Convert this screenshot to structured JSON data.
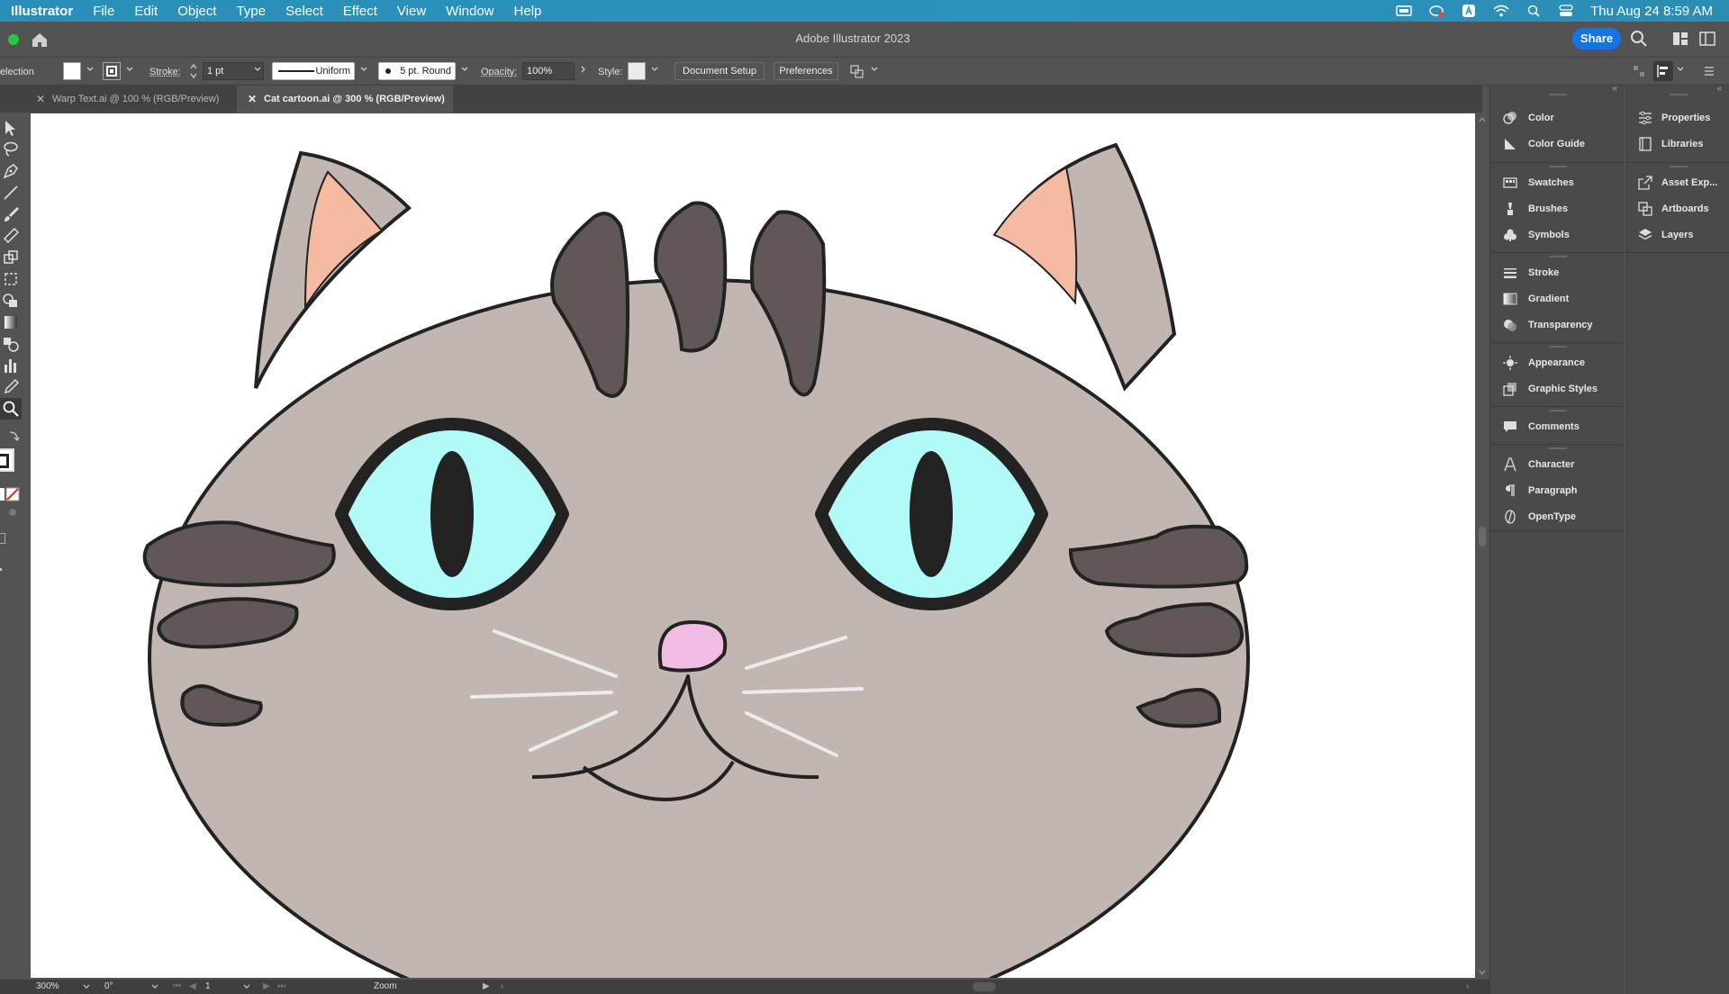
{
  "menubar": {
    "app": "Illustrator",
    "items": [
      "File",
      "Edit",
      "Object",
      "Type",
      "Select",
      "Effect",
      "View",
      "Window",
      "Help"
    ],
    "clock": "Thu Aug 24  8:59 AM"
  },
  "window": {
    "title": "Adobe Illustrator 2023",
    "share_label": "Share"
  },
  "controlbar": {
    "selection_label": "election",
    "stroke_label": "Stroke:",
    "stroke_weight": "1 pt",
    "profile": "Uniform",
    "brush": "5 pt. Round",
    "opacity_label": "Opacity:",
    "opacity_value": "100%",
    "style_label": "Style:",
    "document_setup": "Document Setup",
    "preferences": "Preferences"
  },
  "tabs": [
    {
      "label": "Warp Text.ai @ 100 % (RGB/Preview)",
      "active": false
    },
    {
      "label": "Cat cartoon.ai @ 300 % (RGB/Preview)",
      "active": true
    }
  ],
  "statusbar": {
    "zoom": "300%",
    "rotation": "0°",
    "artboard": "1",
    "tool": "Zoom"
  },
  "panels_col1": [
    {
      "label": "Color",
      "icon": "color-icon"
    },
    {
      "label": "Color Guide",
      "icon": "color-guide-icon"
    },
    {
      "label": "Swatches",
      "icon": "swatches-icon"
    },
    {
      "label": "Brushes",
      "icon": "brushes-icon"
    },
    {
      "label": "Symbols",
      "icon": "symbols-icon"
    },
    {
      "label": "Stroke",
      "icon": "stroke-icon"
    },
    {
      "label": "Gradient",
      "icon": "gradient-icon"
    },
    {
      "label": "Transparency",
      "icon": "transparency-icon"
    },
    {
      "label": "Appearance",
      "icon": "appearance-icon"
    },
    {
      "label": "Graphic Styles",
      "icon": "graphic-styles-icon"
    },
    {
      "label": "Comments",
      "icon": "comments-icon"
    },
    {
      "label": "Character",
      "icon": "character-icon"
    },
    {
      "label": "Paragraph",
      "icon": "paragraph-icon"
    },
    {
      "label": "OpenType",
      "icon": "opentype-icon"
    }
  ],
  "panels_col2": [
    {
      "label": "Properties",
      "icon": "properties-icon"
    },
    {
      "label": "Libraries",
      "icon": "libraries-icon"
    },
    {
      "label": "Asset Exp...",
      "icon": "asset-export-icon"
    },
    {
      "label": "Artboards",
      "icon": "artboards-icon"
    },
    {
      "label": "Layers",
      "icon": "layers-icon"
    }
  ],
  "colors": {
    "menubar": "#2b93bd",
    "share": "#1473e6",
    "cat_fur": "#c1b6b2",
    "cat_stripes": "#5f5856",
    "inner_ear": "#f5bba2",
    "eyes": "#b2faf8",
    "nose": "#f2bce3"
  }
}
